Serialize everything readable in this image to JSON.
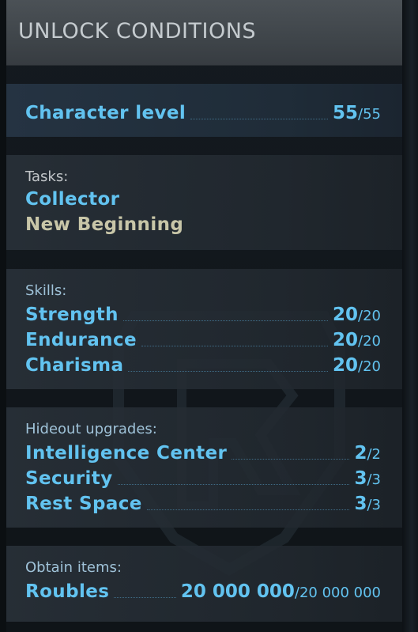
{
  "header": {
    "title": "UNLOCK CONDITIONS"
  },
  "level": {
    "label": "Character level",
    "current": "55",
    "max": "/55"
  },
  "tasks": {
    "caption": "Tasks:",
    "items": [
      {
        "name": "Collector",
        "status": "active"
      },
      {
        "name": "New Beginning",
        "status": "done"
      }
    ]
  },
  "skills": {
    "caption": "Skills:",
    "items": [
      {
        "name": "Strength",
        "current": "20",
        "max": "/20"
      },
      {
        "name": "Endurance",
        "current": "20",
        "max": "/20"
      },
      {
        "name": "Charisma",
        "current": "20",
        "max": "/20"
      }
    ]
  },
  "hideout": {
    "caption": "Hideout upgrades:",
    "items": [
      {
        "name": "Intelligence Center",
        "current": "2",
        "max": "/2"
      },
      {
        "name": "Security",
        "current": "3",
        "max": "/3"
      },
      {
        "name": "Rest Space",
        "current": "3",
        "max": "/3"
      }
    ]
  },
  "obtain": {
    "caption": "Obtain items:",
    "items": [
      {
        "name": "Roubles",
        "current": "20 000 000",
        "max": "/20 000 000"
      }
    ]
  },
  "colors": {
    "accent": "#62c3f0",
    "task_done": "#c8c6a8",
    "header_bg": "#454b50",
    "header_text": "#c5cbcf"
  },
  "icons": {
    "background_emblem": "faction-emblem-icon"
  }
}
